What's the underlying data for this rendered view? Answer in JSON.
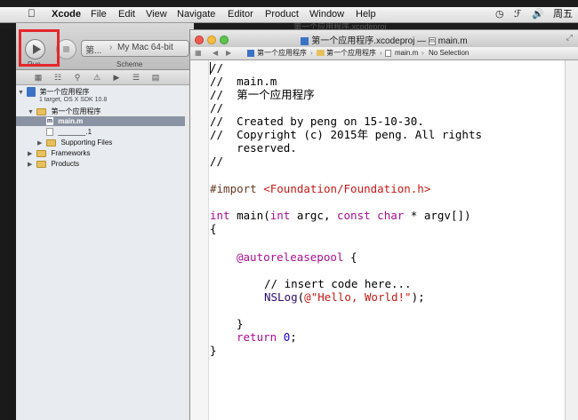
{
  "menubar": {
    "items": [
      "Xcode",
      "File",
      "Edit",
      "View",
      "Navigate",
      "Editor",
      "Product",
      "Window",
      "Help"
    ],
    "clock": "周五"
  },
  "toolbar": {
    "run_label": "Run",
    "scheme_label": "Scheme",
    "scheme_target": "第...",
    "scheme_destination": "My Mac 64-bit",
    "behind_title": "第一个应用程序.xcodeproj"
  },
  "navigator": {
    "project_name": "第一个应用程序",
    "project_subtitle": "1 target, OS X SDK 10.8",
    "group_name": "第一个应用程序",
    "file_main": "main.m",
    "file_manpage": "_______.1",
    "supporting": "Supporting Files",
    "frameworks": "Frameworks",
    "products": "Products"
  },
  "editor": {
    "title_project": "第一个应用程序.xcodeproj",
    "title_separator": "—",
    "title_file": "main.m",
    "jumpbar": [
      "第一个应用程序",
      "第一个应用程序",
      "main.m",
      "No Selection"
    ]
  },
  "code": {
    "l1": "//",
    "l2": "//  main.m",
    "l3": "//  第一个应用程序",
    "l4": "//",
    "l5": "//  Created by peng on 15-10-30.",
    "l6": "//  Copyright (c) 2015年 peng. All rights",
    "l7": "    reserved.",
    "l8": "//",
    "import_kw": "#import",
    "import_path": " <Foundation/Foundation.h>",
    "main_int1": "int",
    "main_name": " main(",
    "main_int2": "int",
    "main_argc": " argc, ",
    "main_const": "const",
    "main_space": " ",
    "main_char": "char",
    "main_rest": " * argv[])",
    "brace_open": "{",
    "autorelease": "@autoreleasepool",
    "autorelease_brace": " {",
    "comment_insert": "// insert code here...",
    "nslog": "NSLog",
    "nslog_open": "(",
    "nslog_str": "@\"Hello, World!\"",
    "nslog_close": ");",
    "inner_close": "}",
    "return_kw": "return",
    "return_space": " ",
    "return_val": "0",
    "return_semi": ";",
    "brace_close": "}"
  }
}
